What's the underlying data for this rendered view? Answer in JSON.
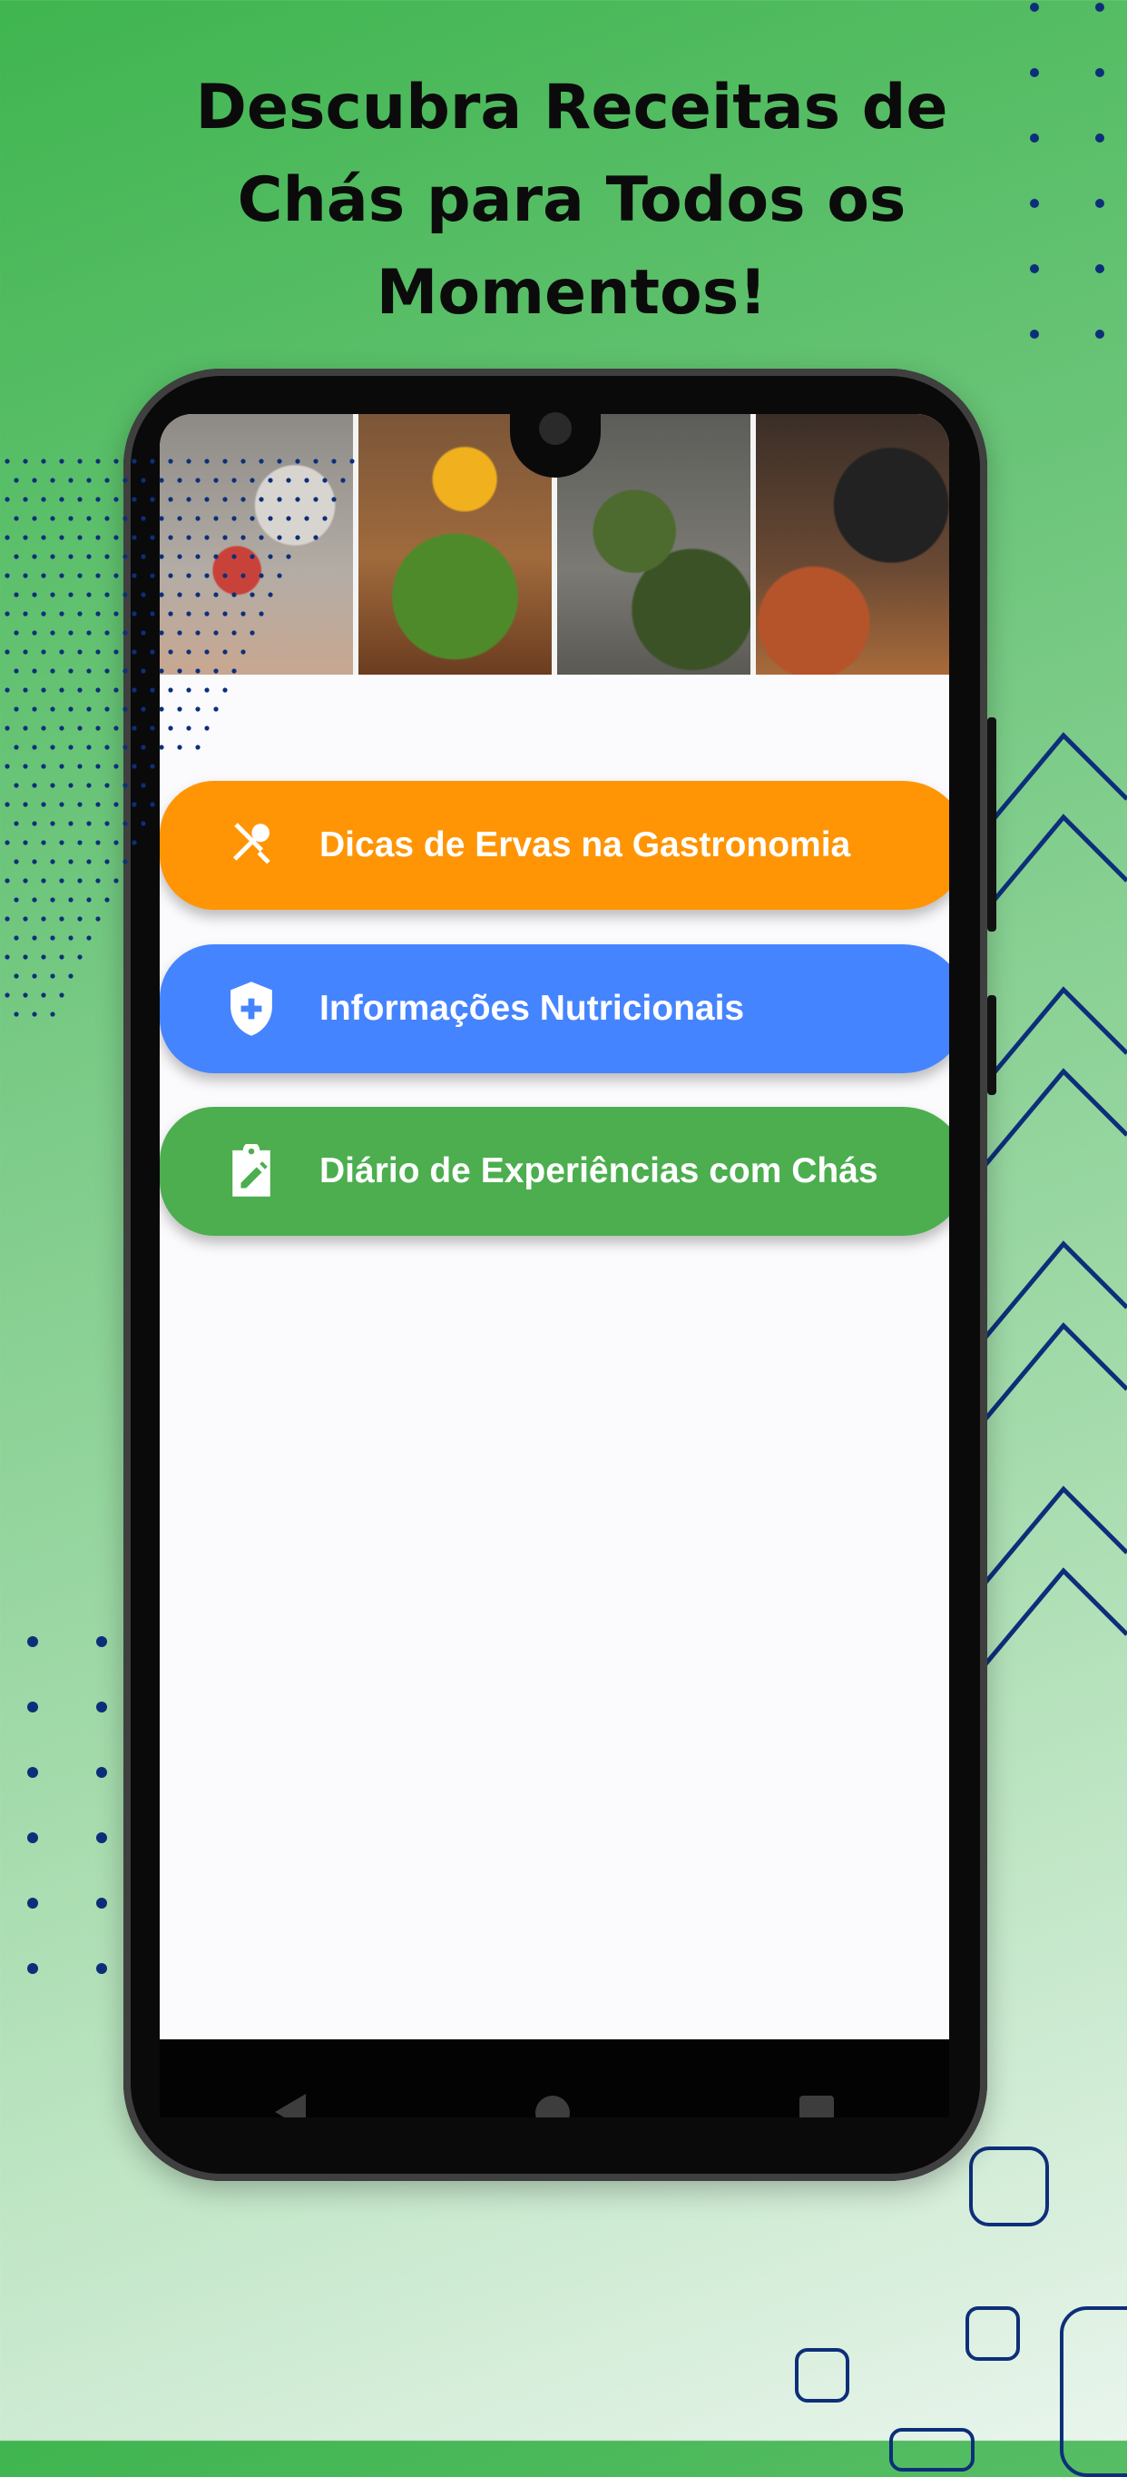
{
  "headline": {
    "line1": "Descubra Receitas de",
    "line2": "Chás para Todos os",
    "line3": "Momentos!"
  },
  "screen": {
    "menu": [
      {
        "label": "Dicas de Ervas na Gastronomia",
        "icon": "fork-spoon-icon",
        "color": "#ff9505"
      },
      {
        "label": "Informações Nutricionais",
        "icon": "health-shield-icon",
        "color": "#4584ff"
      },
      {
        "label": "Diário de Experiências com Chás",
        "icon": "edit-clipboard-icon",
        "color": "#4cae4f"
      }
    ],
    "navbar": [
      "back-icon",
      "home-icon",
      "recents-icon"
    ]
  },
  "colors": {
    "background_green": "#3fb54f",
    "decor_navy": "#0d2f7a"
  }
}
